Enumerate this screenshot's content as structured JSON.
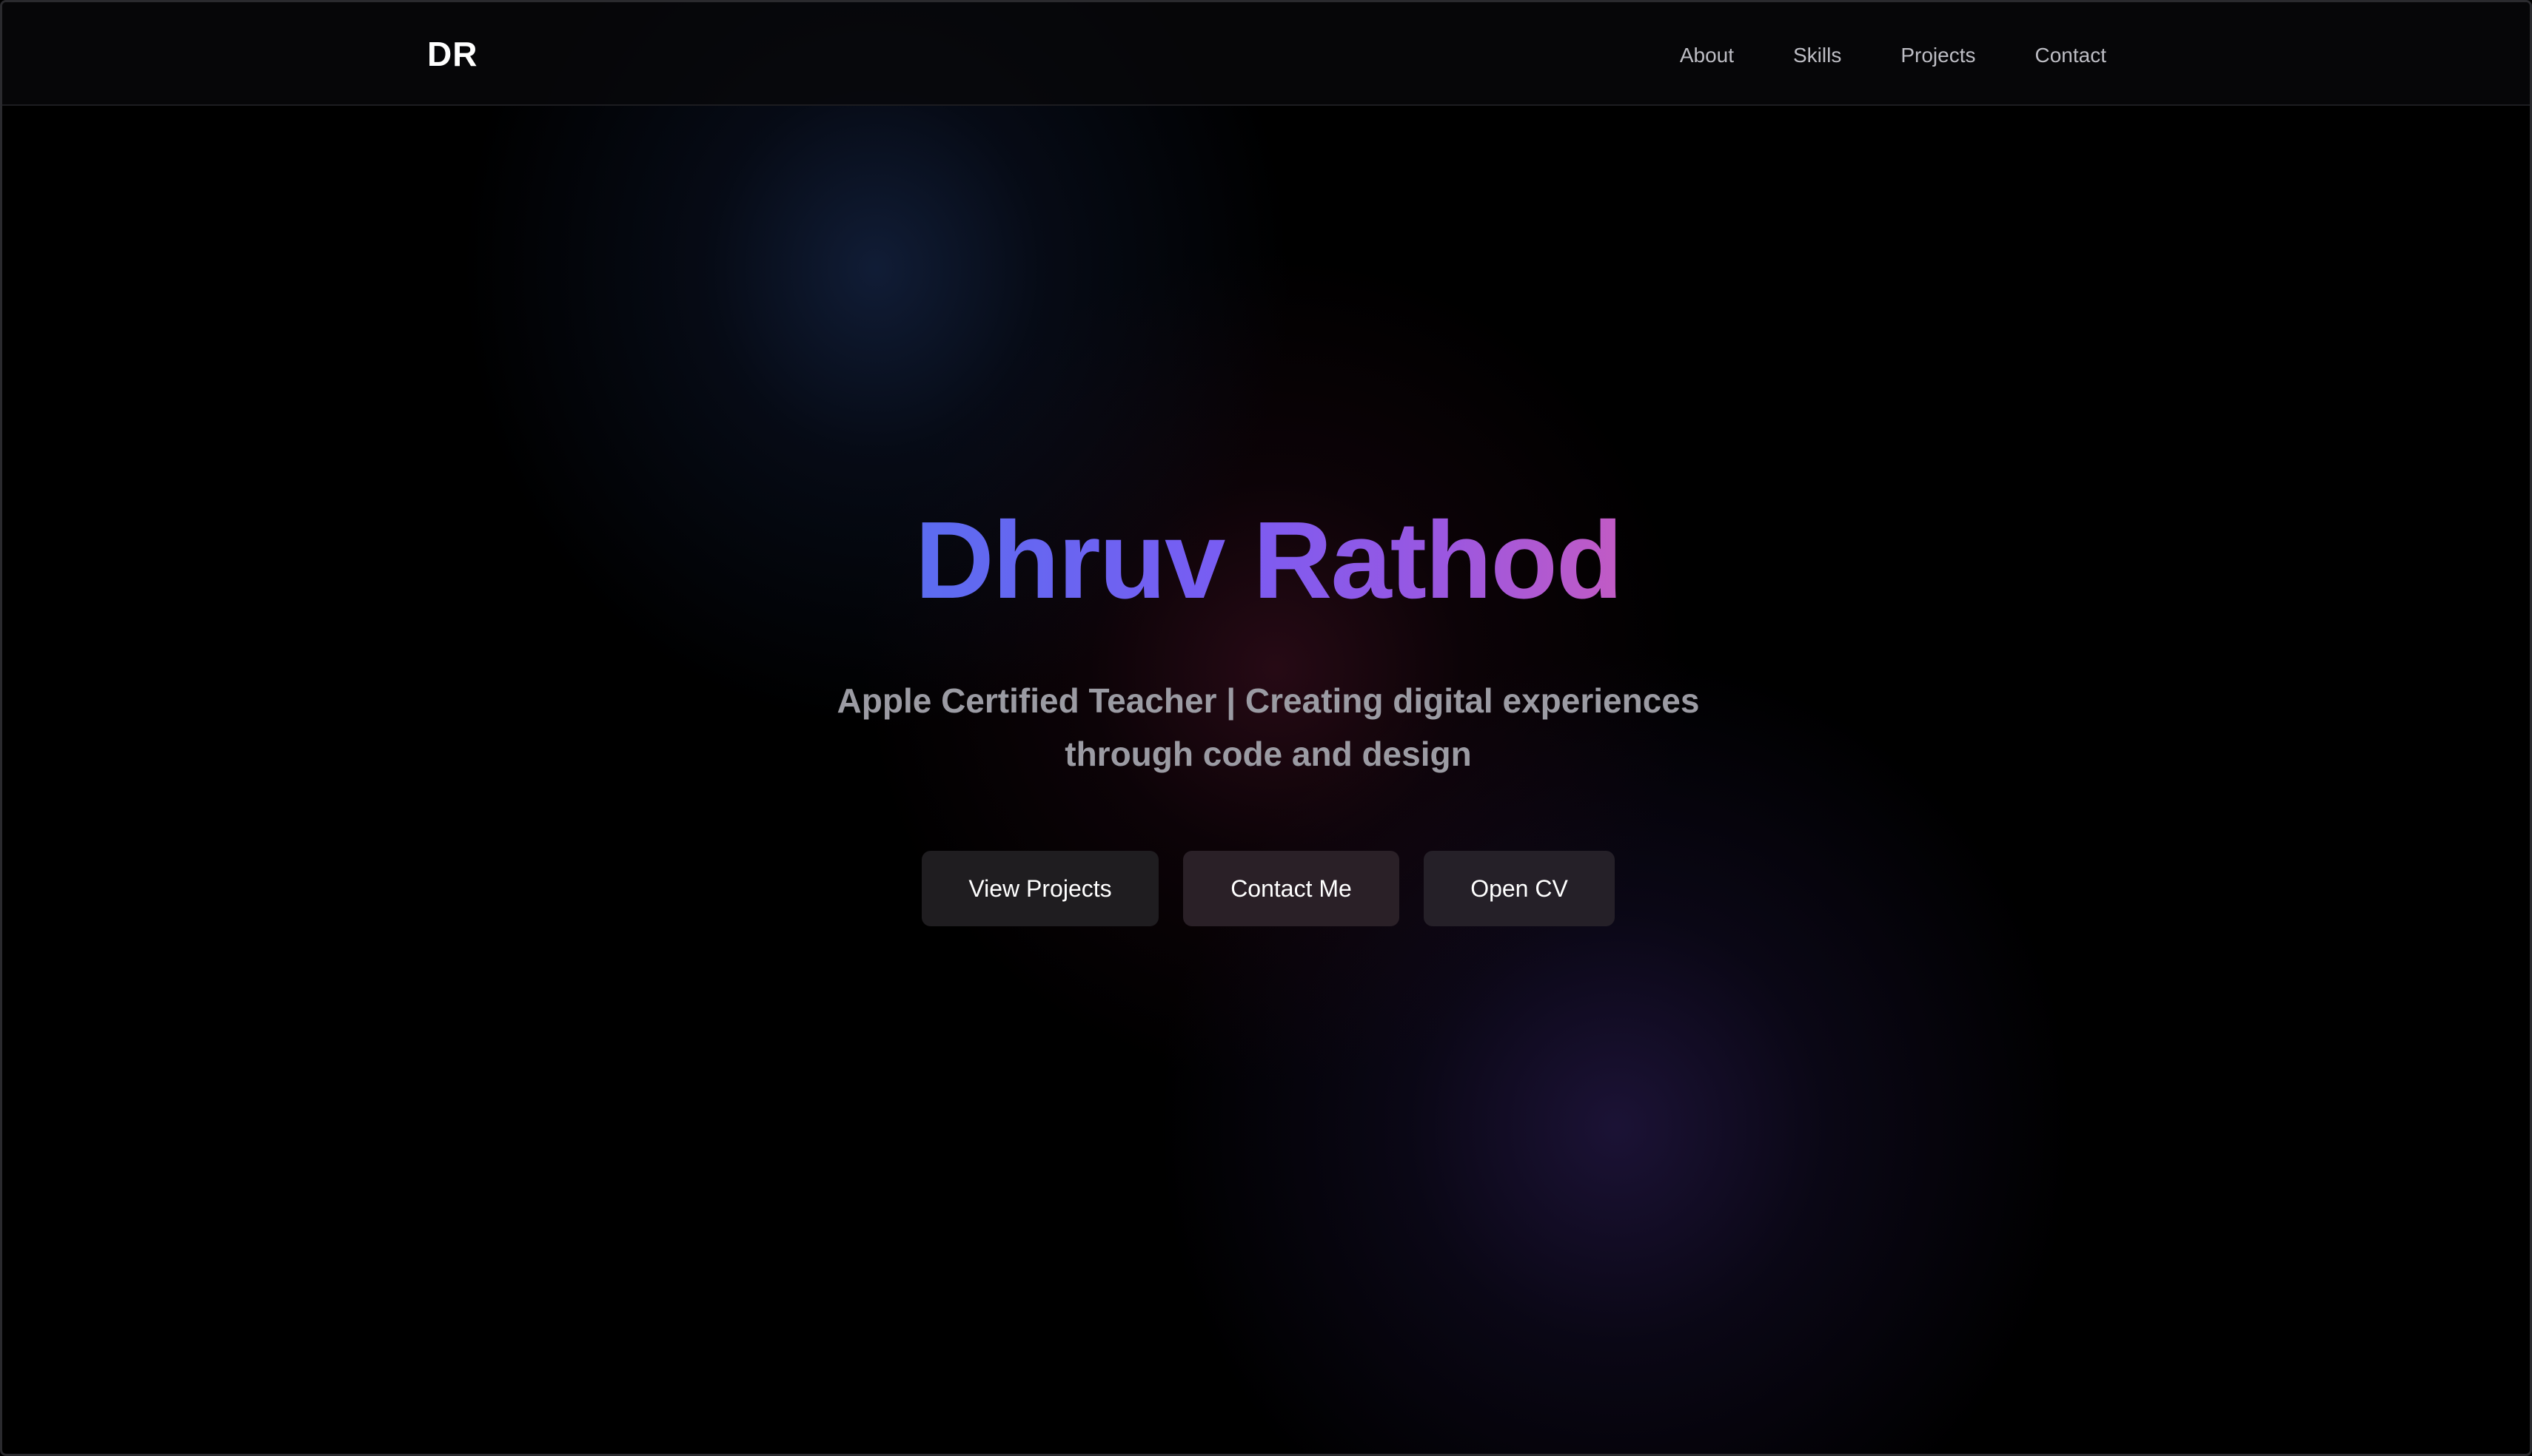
{
  "navbar": {
    "logo": "DR",
    "links": [
      "About",
      "Skills",
      "Projects",
      "Contact"
    ]
  },
  "hero": {
    "title": "Dhruv Rathod",
    "subtitle": "Apple Certified Teacher | Creating digital experiences through code and design",
    "buttons": [
      "View Projects",
      "Contact Me",
      "Open CV"
    ]
  },
  "colors": {
    "background": "#000000",
    "title_gradient": [
      "#5b6cf0",
      "#7a5cf2",
      "#9b57e0",
      "#c25bc4"
    ],
    "subtitle": "#9b9ba3",
    "nav_link": "#bdbdc4"
  }
}
